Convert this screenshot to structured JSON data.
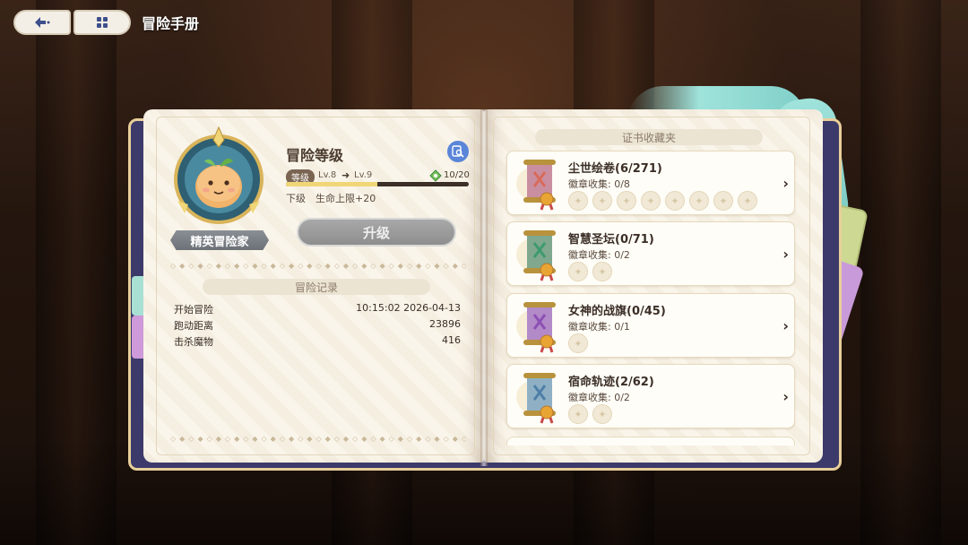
{
  "header": {
    "title": "冒险手册"
  },
  "left_page": {
    "rank_badge": "精英冒险家",
    "level": {
      "title": "冒险等级",
      "tag": "等级",
      "current": "Lv.8",
      "next": "Lv.9",
      "exp_text": "10/20",
      "exp_fraction": 0.5,
      "next_label": "下级",
      "next_reward": "生命上限+20",
      "upgrade_label": "升级"
    },
    "records": {
      "title": "冒险记录",
      "rows": [
        {
          "key": "开始冒险",
          "value": "10:15:02  2026-04-13"
        },
        {
          "key": "跑动距离",
          "value": "23896"
        },
        {
          "key": "击杀魔物",
          "value": "416"
        }
      ]
    }
  },
  "right_page": {
    "title": "证书收藏夹",
    "cards": [
      {
        "title": "尘世绘卷(6/271)",
        "badges_label": "徽章收集: 0/8",
        "badge_count": 8,
        "scroll_color": "#c98fa0",
        "emblem_color": "#d86a5a"
      },
      {
        "title": "智慧圣坛(0/71)",
        "badges_label": "徽章收集: 0/2",
        "badge_count": 2,
        "scroll_color": "#7fa88e",
        "emblem_color": "#3c9a6e"
      },
      {
        "title": "女神的战旗(0/45)",
        "badges_label": "徽章收集: 0/1",
        "badge_count": 1,
        "scroll_color": "#b38ac8",
        "emblem_color": "#8b4fb4"
      },
      {
        "title": "宿命轨迹(2/62)",
        "badges_label": "徽章收集: 0/2",
        "badge_count": 2,
        "scroll_color": "#8fb0c4",
        "emblem_color": "#4e7ea8"
      }
    ]
  },
  "colors": {
    "book_cover": "#3c3a6a",
    "page": "#faf5ea",
    "accent_blue": "#5a85d8",
    "exp_fill": "#f0d676"
  },
  "icons": [
    "back-arrow-icon",
    "grid-menu-icon",
    "magnifier-icon",
    "exp-gem-icon",
    "chevron-right-icon",
    "badge-slot-icon"
  ]
}
